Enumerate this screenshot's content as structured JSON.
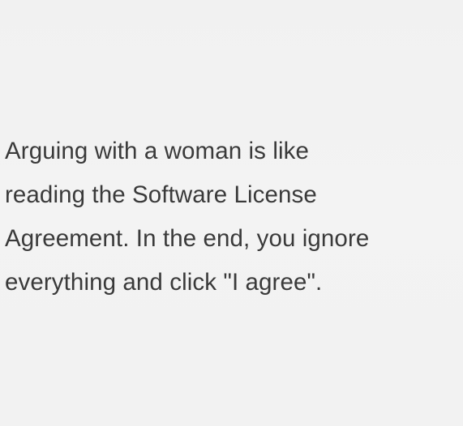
{
  "quote": {
    "lines": [
      "Arguing with a woman is like",
      "reading the Software License",
      "Agreement. In the end, you ignore",
      "everything and click \"I agree\"."
    ]
  }
}
